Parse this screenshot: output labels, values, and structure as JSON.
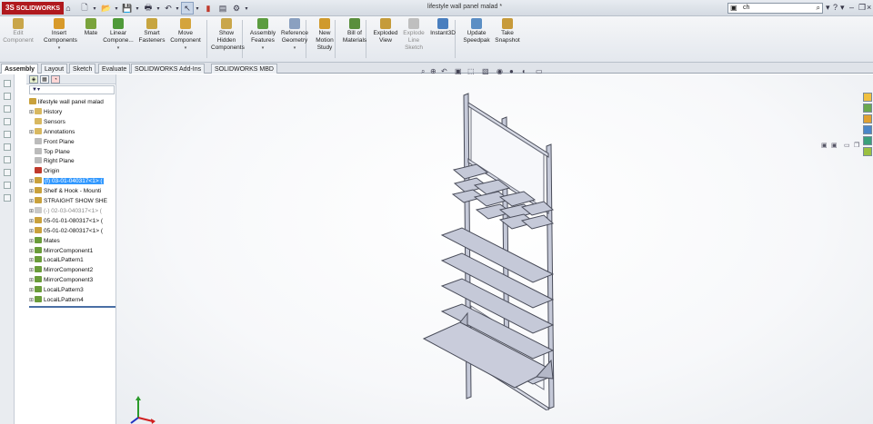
{
  "app": {
    "logo_prefix": "3S",
    "logo": "SOLIDWORKS",
    "document_title": "lifestyle wall panel malad *"
  },
  "search": {
    "value": "ch"
  },
  "quick_access": [
    "new-icon",
    "open-icon",
    "save-icon",
    "print-icon",
    "undo-icon",
    "select-icon",
    "rebuild-icon",
    "file-properties-icon",
    "options-icon"
  ],
  "commands": [
    {
      "label": "Edit\nComponent",
      "icon": "edit-component-icon",
      "color": "#c9a64a",
      "dim": true
    },
    {
      "label": "Insert\nComponents",
      "icon": "insert-components-icon",
      "color": "#d89a2a",
      "dd": true
    },
    {
      "label": "Mate",
      "icon": "mate-icon",
      "color": "#7aa33c"
    },
    {
      "label": "Linear\nCompone...",
      "icon": "linear-pattern-icon",
      "color": "#4f9a3a",
      "dd": true
    },
    {
      "label": "Smart\nFasteners",
      "icon": "smart-fasteners-icon",
      "color": "#c7a540"
    },
    {
      "label": "Move\nComponent",
      "icon": "move-component-icon",
      "color": "#d4a43c",
      "dd": true
    },
    {
      "label": "Show\nHidden\nComponents",
      "icon": "show-hidden-icon",
      "color": "#c9a64a"
    },
    {
      "label": "Assembly\nFeatures",
      "icon": "assembly-features-icon",
      "color": "#5c9c40",
      "dd": true
    },
    {
      "label": "Reference\nGeometry",
      "icon": "reference-geometry-icon",
      "color": "#8aa0c0",
      "dd": true
    },
    {
      "label": "New\nMotion\nStudy",
      "icon": "motion-study-icon",
      "color": "#d09a2c"
    },
    {
      "label": "Bill of\nMaterials",
      "icon": "bom-icon",
      "color": "#5a8f3d"
    },
    {
      "label": "Exploded\nView",
      "icon": "exploded-view-icon",
      "color": "#c59b3a"
    },
    {
      "label": "Explode\nLine\nSketch",
      "icon": "explode-line-icon",
      "color": "#bfbfbf",
      "dim": true
    },
    {
      "label": "Instant3D",
      "icon": "instant3d-icon",
      "color": "#4a7fbf"
    },
    {
      "label": "Update\nSpeedpak",
      "icon": "speedpak-icon",
      "color": "#5b8ec4"
    },
    {
      "label": "Take\nSnapshot",
      "icon": "snapshot-icon",
      "color": "#c79a3a"
    }
  ],
  "tabs": [
    "Assembly",
    "Layout",
    "Sketch",
    "Evaluate",
    "SOLIDWORKS Add-Ins",
    "SOLIDWORKS MBD"
  ],
  "tree": [
    {
      "label": "lifestyle wall panel malad",
      "icon": "assembly-icon",
      "color": "#c9a13c",
      "indent": 0,
      "exp": ""
    },
    {
      "label": "History",
      "icon": "history-icon",
      "color": "#d8b860",
      "indent": 1,
      "exp": "+"
    },
    {
      "label": "Sensors",
      "icon": "sensors-icon",
      "color": "#d8b860",
      "indent": 1,
      "exp": ""
    },
    {
      "label": "Annotations",
      "icon": "annotations-icon",
      "color": "#d8b860",
      "indent": 1,
      "exp": "+"
    },
    {
      "label": "Front Plane",
      "icon": "plane-icon",
      "color": "#bbb",
      "indent": 1,
      "exp": ""
    },
    {
      "label": "Top Plane",
      "icon": "plane-icon",
      "color": "#bbb",
      "indent": 1,
      "exp": ""
    },
    {
      "label": "Right Plane",
      "icon": "plane-icon",
      "color": "#bbb",
      "indent": 1,
      "exp": ""
    },
    {
      "label": "Origin",
      "icon": "origin-icon",
      "color": "#c0392b",
      "indent": 1,
      "exp": ""
    },
    {
      "label": "(f) 03-01-040317<1> (",
      "icon": "part-icon",
      "color": "#c9a13c",
      "indent": 1,
      "exp": "+",
      "hl": true
    },
    {
      "label": "Shelf & Hook - Mounti",
      "icon": "subassembly-icon",
      "color": "#c9a13c",
      "indent": 1,
      "exp": "+"
    },
    {
      "label": "STRAIGHT SHOW SHE",
      "icon": "subassembly-icon",
      "color": "#c9a13c",
      "indent": 1,
      "exp": "+"
    },
    {
      "label": "(-) 02-03-040317<1> (",
      "icon": "part-icon",
      "color": "#c8c8c8",
      "indent": 1,
      "exp": "+",
      "grey": true
    },
    {
      "label": "05-01-01-080317<1> (",
      "icon": "part-icon",
      "color": "#c9a13c",
      "indent": 1,
      "exp": "+"
    },
    {
      "label": "05-01-02-080317<1> (",
      "icon": "part-icon",
      "color": "#c9a13c",
      "indent": 1,
      "exp": "+"
    },
    {
      "label": "Mates",
      "icon": "mates-icon",
      "color": "#6a9c3a",
      "indent": 1,
      "exp": "+"
    },
    {
      "label": "MirrorComponent1",
      "icon": "mirror-icon",
      "color": "#6a9c3a",
      "indent": 1,
      "exp": "+"
    },
    {
      "label": "LocalLPattern1",
      "icon": "pattern-icon",
      "color": "#6a9c3a",
      "indent": 1,
      "exp": "+"
    },
    {
      "label": "MirrorComponent2",
      "icon": "mirror-icon",
      "color": "#6a9c3a",
      "indent": 1,
      "exp": "+"
    },
    {
      "label": "MirrorComponent3",
      "icon": "mirror-icon",
      "color": "#6a9c3a",
      "indent": 1,
      "exp": "+"
    },
    {
      "label": "LocalLPattern3",
      "icon": "pattern-icon",
      "color": "#6a9c3a",
      "indent": 1,
      "exp": "+"
    },
    {
      "label": "LocalLPattern4",
      "icon": "pattern-icon",
      "color": "#6a9c3a",
      "indent": 1,
      "exp": "+"
    }
  ],
  "heads_up": [
    "zoom-to-fit-icon",
    "zoom-area-icon",
    "previous-view-icon",
    "section-view-icon",
    "view-orientation-icon",
    "display-style-icon",
    "hide-show-icon",
    "edit-appearance-icon",
    "scene-icon",
    "view-settings-icon"
  ],
  "task_pane": [
    "resources-icon",
    "design-library-icon",
    "file-explorer-icon",
    "view-palette-icon",
    "appearances-icon",
    "custom-properties-icon"
  ],
  "colors": {
    "selection": "#3399ff",
    "model": "#c5c9d8",
    "brand": "#b0191e"
  }
}
